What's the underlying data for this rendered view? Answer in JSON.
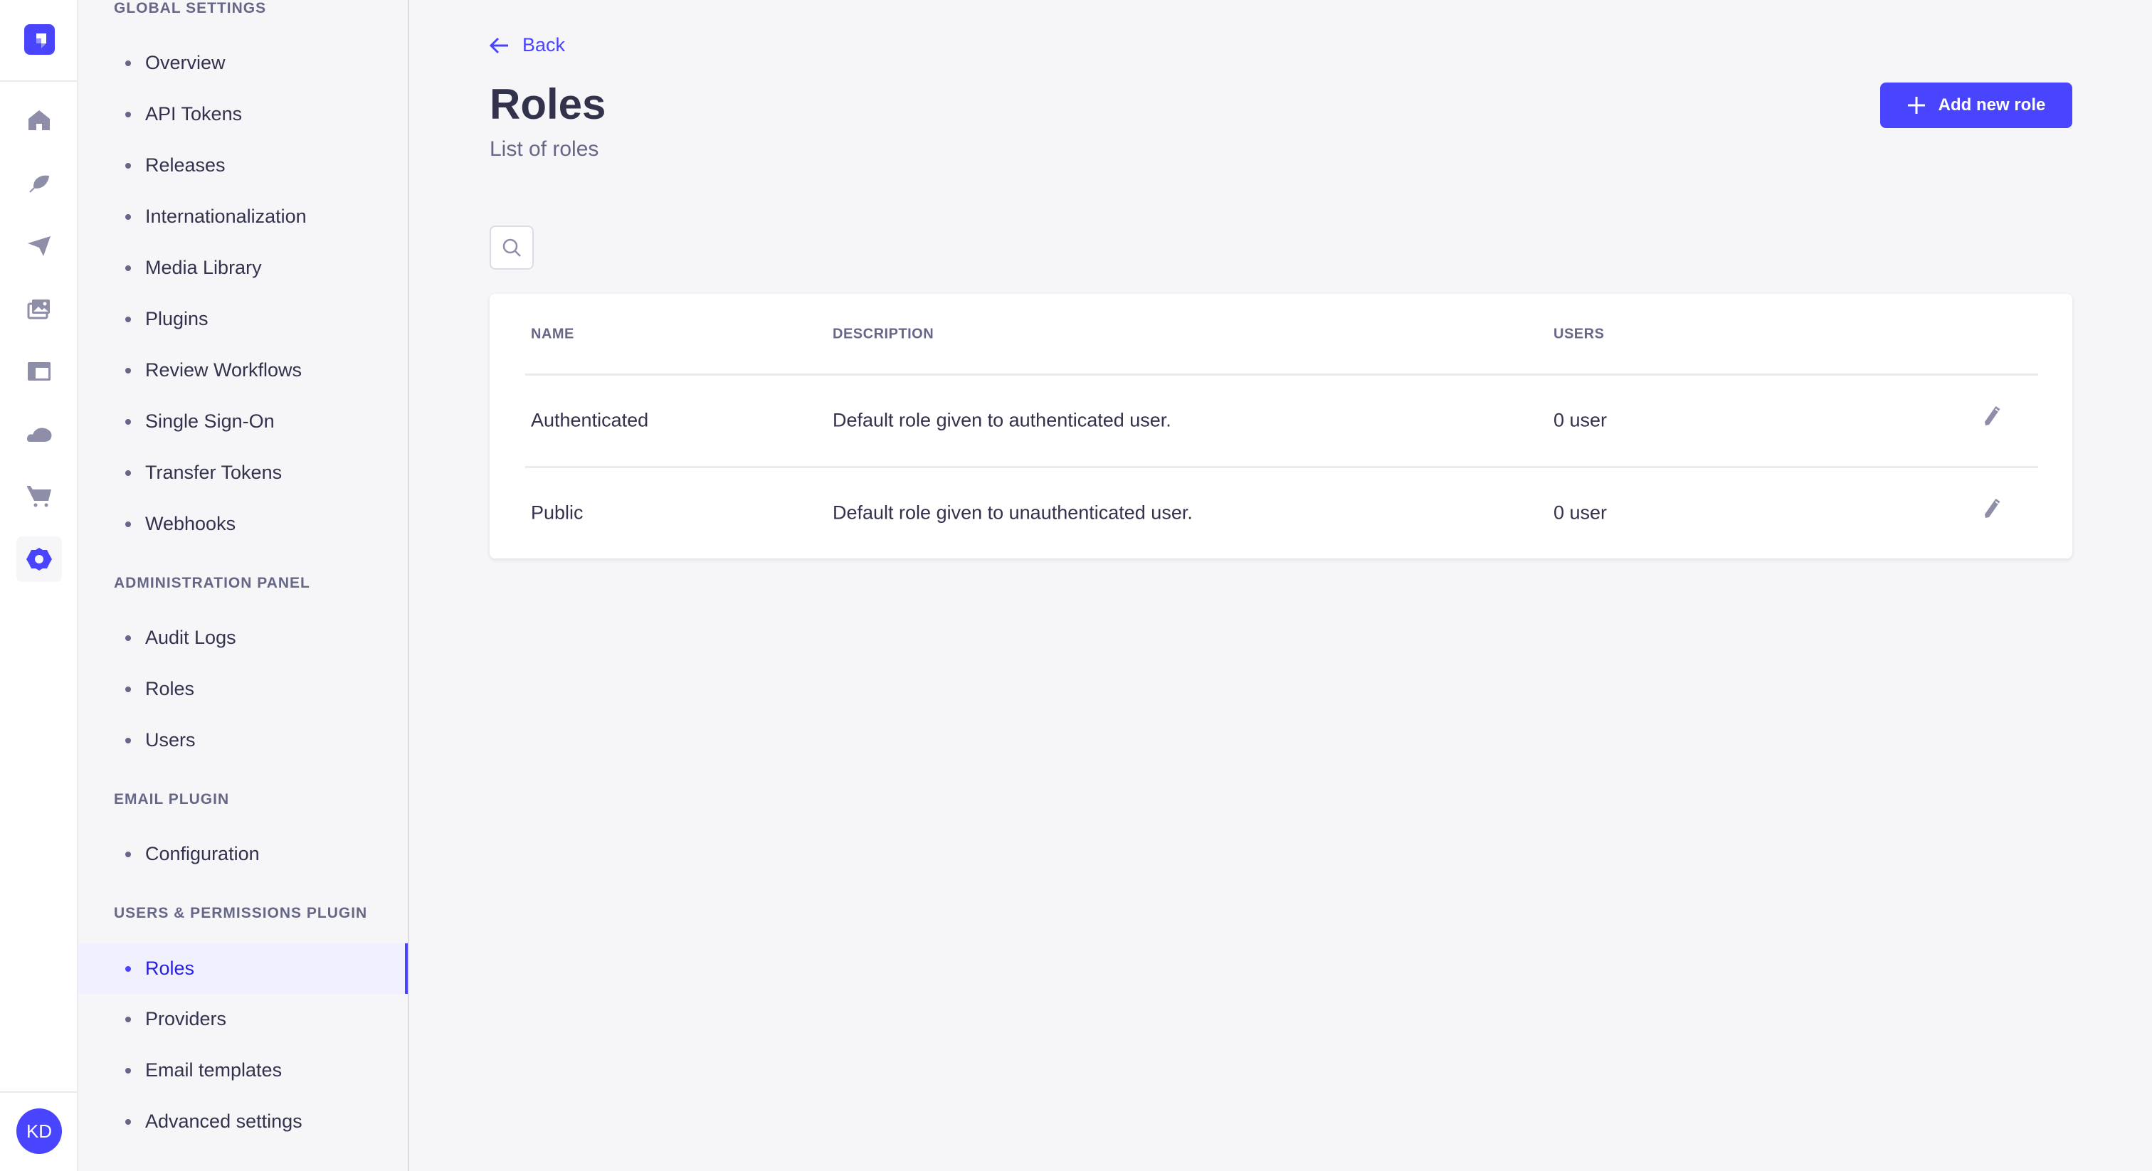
{
  "rail": {
    "logo_icon": "strapi-logo-icon",
    "items": [
      {
        "name": "home",
        "icon": "home-icon",
        "active": false
      },
      {
        "name": "content-manager",
        "icon": "feather-icon",
        "active": false
      },
      {
        "name": "deploy",
        "icon": "paper-plane-icon",
        "active": false
      },
      {
        "name": "media-library",
        "icon": "images-icon",
        "active": false
      },
      {
        "name": "content-type-builder",
        "icon": "layout-icon",
        "active": false
      },
      {
        "name": "cloud",
        "icon": "cloud-icon",
        "active": false
      },
      {
        "name": "marketplace",
        "icon": "shopping-cart-icon",
        "active": false
      },
      {
        "name": "settings",
        "icon": "gear-icon",
        "active": true
      }
    ],
    "user_initials": "KD"
  },
  "subnav": {
    "sections": [
      {
        "title": "Global Settings",
        "items": [
          "Overview",
          "API Tokens",
          "Releases",
          "Internationalization",
          "Media Library",
          "Plugins",
          "Review Workflows",
          "Single Sign-On",
          "Transfer Tokens",
          "Webhooks"
        ]
      },
      {
        "title": "Administration Panel",
        "items": [
          "Audit Logs",
          "Roles",
          "Users"
        ]
      },
      {
        "title": "Email Plugin",
        "items": [
          "Configuration"
        ]
      },
      {
        "title": "Users & Permissions Plugin",
        "items": [
          "Roles",
          "Providers",
          "Email templates",
          "Advanced settings"
        ]
      }
    ],
    "active": {
      "section": 3,
      "item": 0
    }
  },
  "header": {
    "back_label": "Back",
    "title": "Roles",
    "subtitle": "List of roles",
    "add_button_label": "Add new role"
  },
  "table": {
    "columns": [
      "NAME",
      "DESCRIPTION",
      "USERS"
    ],
    "rows": [
      {
        "name": "Authenticated",
        "description": "Default role given to authenticated user.",
        "users": "0 user"
      },
      {
        "name": "Public",
        "description": "Default role given to unauthenticated user.",
        "users": "0 user"
      }
    ]
  },
  "colors": {
    "primary": "#4945ff",
    "text": "#32324d",
    "muted": "#666687",
    "background": "#f6f6f9"
  }
}
